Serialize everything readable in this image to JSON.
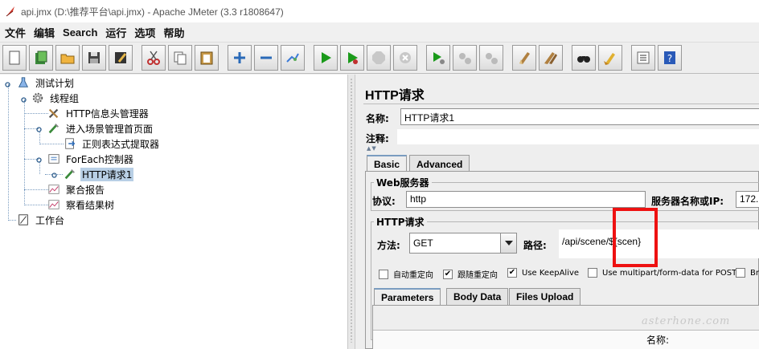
{
  "window": {
    "title": "api.jmx (D:\\推荐平台\\api.jmx) - Apache JMeter (3.3 r1808647)"
  },
  "menu": [
    "文件",
    "编辑",
    "Search",
    "运行",
    "选项",
    "帮助"
  ],
  "toolbar": {
    "buttons": [
      "new-icon",
      "templates-icon",
      "open-icon",
      "save-icon",
      "save-as-icon",
      "cut-icon",
      "copy-icon",
      "paste-icon",
      "expand-icon",
      "collapse-icon",
      "toggle-icon",
      "start-icon",
      "start-no-pause-icon",
      "stop-icon",
      "shutdown-icon",
      "remote-start-icon",
      "remote-stop-icon",
      "remote-shutdown-icon",
      "clear-icon",
      "clear-all-icon",
      "search-icon",
      "reset-search-icon",
      "function-helper-icon",
      "help-icon"
    ]
  },
  "tree": {
    "items": [
      {
        "label": "测试计划",
        "icon": "test-plan-icon"
      },
      {
        "label": "线程组",
        "icon": "thread-group-icon"
      },
      {
        "label": "HTTP信息头管理器",
        "icon": "tools-icon"
      },
      {
        "label": "进入场景管理首页面",
        "icon": "sampler-icon"
      },
      {
        "label": "正则表达式提取器",
        "icon": "extractor-icon"
      },
      {
        "label": "ForEach控制器",
        "icon": "controller-icon"
      },
      {
        "label": "HTTP请求1",
        "icon": "sampler-icon"
      },
      {
        "label": "聚合报告",
        "icon": "graph-icon"
      },
      {
        "label": "察看结果树",
        "icon": "graph-icon"
      },
      {
        "label": "工作台",
        "icon": "workbench-icon"
      }
    ]
  },
  "panel": {
    "title": "HTTP请求",
    "name_label": "名称:",
    "name_value": "HTTP请求1",
    "comment_label": "注释:",
    "tabs": [
      "Basic",
      "Advanced"
    ],
    "web_server": {
      "group_title": "Web服务器",
      "protocol_label": "协议:",
      "protocol_value": "http",
      "server_label": "服务器名称或IP:",
      "server_value": "172."
    },
    "http_request": {
      "group_title": "HTTP请求",
      "method_label": "方法:",
      "method_value": "GET",
      "path_label": "路径:",
      "path_value": "/api/scene/${scen}"
    },
    "checkboxes": [
      {
        "label": "自动重定向",
        "checked": false
      },
      {
        "label": "跟随重定向",
        "checked": true
      },
      {
        "label": "Use KeepAlive",
        "checked": true
      },
      {
        "label": "Use multipart/form-data for POST",
        "checked": false
      },
      {
        "label": "Br",
        "checked": false
      }
    ],
    "sub_tabs": [
      "Parameters",
      "Body Data",
      "Files Upload"
    ],
    "param_name_header": "名称:"
  },
  "colors": {
    "selection": "#b8cfe5",
    "highlight_box": "#ee1111",
    "tab_accent": "#7a9cc0"
  },
  "watermark": "asterhone.com"
}
